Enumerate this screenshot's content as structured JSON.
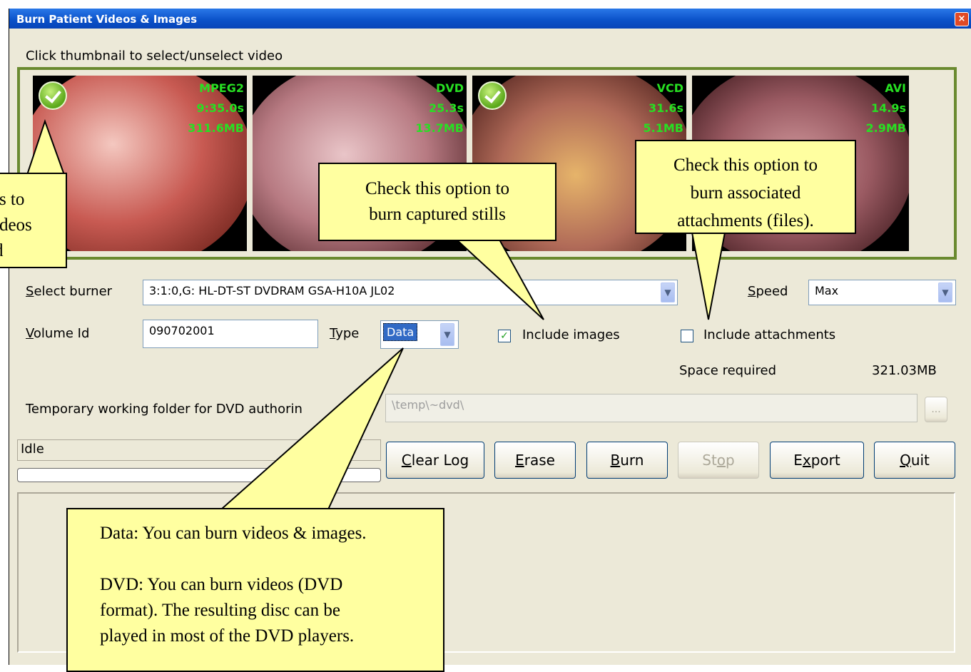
{
  "window": {
    "title": "Burn Patient Videos & Images",
    "close_label": "×"
  },
  "instruction": "Click thumbnail to select/unselect video",
  "thumbnails": [
    {
      "format": "MPEG2",
      "duration": "9:35.0s",
      "size": "311.6MB",
      "selected": true
    },
    {
      "format": "DVD",
      "duration": "25.3s",
      "size": "13.7MB",
      "selected": false
    },
    {
      "format": "VCD",
      "duration": "31.6s",
      "size": "5.1MB",
      "selected": true
    },
    {
      "format": "AVI",
      "duration": "14.9s",
      "size": "2.9MB",
      "selected": false
    }
  ],
  "form": {
    "burner_label_prefix": "",
    "burner_label_access": "S",
    "burner_label_rest": "elect burner",
    "burner_value": "3:1:0,G: HL-DT-ST DVDRAM GSA-H10A  JL02",
    "speed_access": "S",
    "speed_rest": "peed",
    "speed_value": "Max",
    "volume_access": "V",
    "volume_rest": "olume Id",
    "volume_value": "090702001",
    "type_access": "T",
    "type_rest": "ype",
    "type_value": "Data",
    "include_images_label": "Include images",
    "include_images_checked": "✓",
    "include_attachments_label": "Include attachments",
    "space_required_label": "Space required",
    "space_required_value": "321.03MB",
    "temp_folder_label": "Temporary working folder for DVD authorin",
    "temp_folder_value": "\\temp\\~dvd\\",
    "browse_label": "..."
  },
  "status": {
    "text": "Idle",
    "progress": 0
  },
  "buttons": {
    "clear_log": {
      "access": "C",
      "rest": "lear Log"
    },
    "erase": {
      "access": "E",
      "rest": "rase"
    },
    "burn": {
      "access": "B",
      "rest": "urn"
    },
    "stop": {
      "pre": "St",
      "access": "o",
      "rest": "p"
    },
    "export": {
      "pre": "E",
      "access": "x",
      "rest": "port"
    },
    "quit": {
      "access": "Q",
      "rest": "uit"
    }
  },
  "callouts": {
    "left_partial": [
      "ls to",
      "ideos",
      "d"
    ],
    "stills": [
      "Check this option to",
      "burn captured stills"
    ],
    "attachments": [
      "Check this option to",
      "burn associated",
      "attachments (files)."
    ],
    "data_type": [
      "Data: You can burn videos & images.",
      "",
      "DVD: You can burn videos (DVD",
      "format). The resulting disc can be",
      "played in most of the DVD players."
    ]
  },
  "colors": {
    "titlebar": "#0a50c8",
    "thumb_border": "#6a8a2f",
    "thumb_text": "#27e022",
    "callout_bg": "#ffffa0"
  }
}
